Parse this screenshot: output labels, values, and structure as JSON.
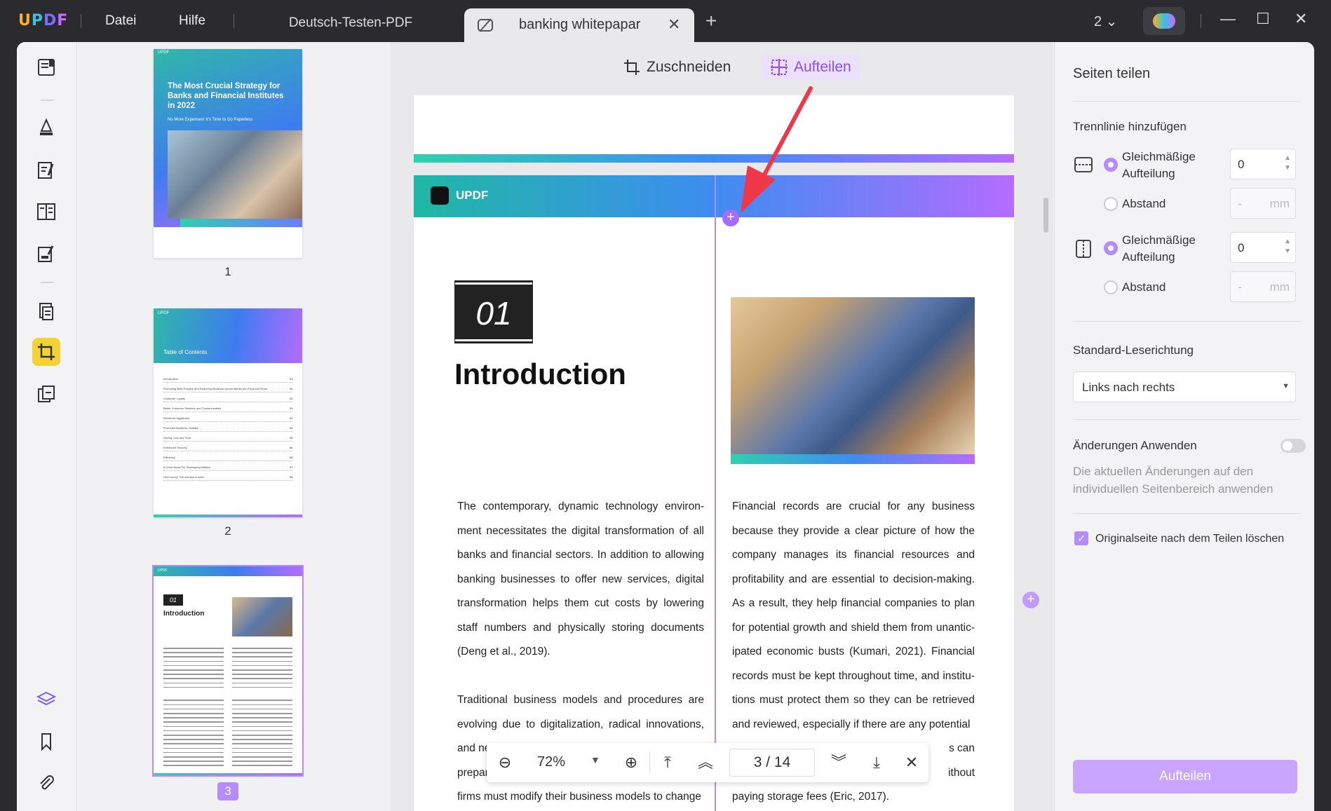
{
  "titlebar": {
    "logo": "UPDF",
    "menu": [
      "Datei",
      "Hilfe"
    ],
    "tabs": [
      {
        "label": "Deutsch-Testen-PDF",
        "active": false
      },
      {
        "label": "banking whitepapar",
        "active": true
      }
    ],
    "window_count": "2"
  },
  "toolbar": {
    "items": [
      "reader-icon",
      "comment-icon",
      "edit-icon",
      "organize-icon",
      "form-icon",
      "convert-icon",
      "crop-icon",
      "combine-icon"
    ],
    "bottom": [
      "layers-icon",
      "bookmark-icon",
      "attachment-icon"
    ]
  },
  "thumbnails": [
    {
      "number": "1",
      "title": "The Most Crucial Strategy for Banks and Financial Institutes in 2022",
      "subtitle": "No More Expenses! It's Time to Go Paperless",
      "badge": "UPDF"
    },
    {
      "number": "2",
      "title": "Table of Contents",
      "badge": "UPDF",
      "toc": [
        "Introduction",
        "Promoting Best Practice and Reducing Workload across Banks and Financial Firms",
        "Customer Loyalty",
        "Better Customer Services and Communication",
        "Electronic signatures",
        "Promotes Business Globally",
        "Saving Cost and Time",
        "Enhanced Security",
        "Efficiency",
        "A Good News For Developing Nations",
        "Don't worry! The solution is here!"
      ],
      "toc_pages": [
        "01",
        "02",
        "02",
        "03",
        "04",
        "04",
        "05",
        "06",
        "06",
        "07",
        "08"
      ]
    },
    {
      "number": "3",
      "heading_number": "01",
      "heading": "Introduction",
      "badge": "UPDF",
      "selected": true
    }
  ],
  "doc_toolbar": {
    "crop_label": "Zuschneiden",
    "split_label": "Aufteilen"
  },
  "page": {
    "brand": "UPDF",
    "section_number": "01",
    "section_title": "Introduction",
    "left_paragraphs": [
      "The contemporary, dynamic technology environ-ment necessitates the digital transformation of all banks and financial sectors. In addition to allowing banking businesses to offer new services, digital transformation helps them cut costs by lowering staff numbers and physically storing documents (Deng et al., 2019).",
      "Traditional business models and procedures are evolving due to digitalization, radical innovations, and new",
      "prepared",
      "firms must modify their business models to change"
    ],
    "right_paragraph": "Financial records are crucial for any business because they provide a clear picture of how the company manages its financial resources and profitability and are essential to decision-making. As a result, they help financial companies to plan for potential growth and shield them from unantic-ipated economic busts (Kumari, 2021). Financial records must be kept throughout time, and institu-tions must protect them so they can be retrieved and reviewed, especially if there are any potential",
    "right_partial": [
      "s can",
      "ithout"
    ],
    "right_last": "paying storage fees (Eric, 2017)."
  },
  "navbar": {
    "zoom": "72%",
    "current_page": "3",
    "separator": "/",
    "total_pages": "14"
  },
  "panel": {
    "title": "Seiten teilen",
    "section_divider": "Trennlinie hinzufügen",
    "horizontal": {
      "option1": "Gleichmäßige Aufteilung",
      "option1_value": "0",
      "option2": "Abstand",
      "option2_placeholder": "-",
      "unit": "mm"
    },
    "vertical": {
      "option1": "Gleichmäßige Aufteilung",
      "option1_value": "0",
      "option2": "Abstand",
      "option2_placeholder": "-",
      "unit": "mm"
    },
    "reading_direction_label": "Standard-Leserichtung",
    "reading_direction_value": "Links nach rechts",
    "apply_label": "Änderungen Anwenden",
    "apply_description": "Die aktuellen Änderungen auf den individuellen Seitenbereich anwenden",
    "delete_original_label": "Originalseite nach dem Teilen löschen",
    "button": "Aufteilen"
  },
  "colors": {
    "accent": "#b48cff",
    "active_tool": "#f2d335",
    "arrow": "#f0374a"
  }
}
